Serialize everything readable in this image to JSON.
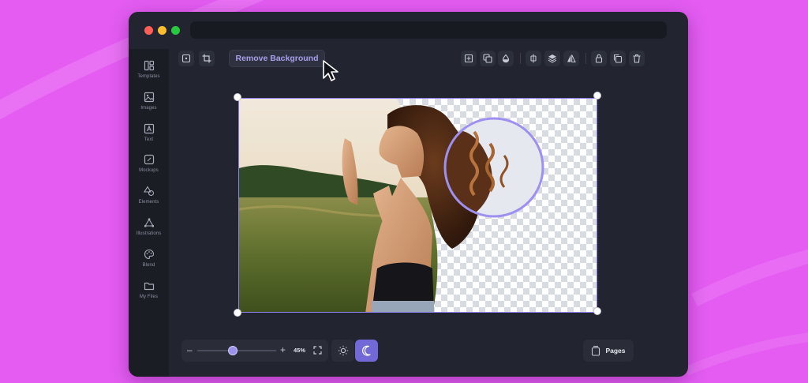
{
  "window": {
    "traffic_lights": [
      "#ff5f57",
      "#febc2e",
      "#28c840"
    ]
  },
  "sidebar": {
    "items": [
      {
        "label": "Templates",
        "icon": "templates-icon"
      },
      {
        "label": "Images",
        "icon": "image-icon"
      },
      {
        "label": "Text",
        "icon": "text-icon"
      },
      {
        "label": "Mockups",
        "icon": "mockup-icon"
      },
      {
        "label": "Elements",
        "icon": "shapes-icon"
      },
      {
        "label": "Illustrations",
        "icon": "illustration-icon"
      },
      {
        "label": "Blend",
        "icon": "palette-icon"
      },
      {
        "label": "My Files",
        "icon": "folder-icon"
      }
    ]
  },
  "toolbar": {
    "remove_background_label": "Remove Background",
    "left_tools": [
      "replace-image-icon",
      "crop-icon"
    ],
    "right_tools": [
      "align-center-icon",
      "arrange-icon",
      "opacity-icon",
      "distribute-icon",
      "layers-icon",
      "flip-icon",
      "lock-icon",
      "duplicate-icon",
      "delete-icon"
    ]
  },
  "zoom": {
    "minus": "–",
    "plus": "+",
    "value_label": "45%",
    "level_fraction": 0.45
  },
  "theme": {
    "selected": "dark"
  },
  "pages": {
    "label": "Pages"
  },
  "colors": {
    "background": "#e45cf2",
    "accent": "#8b80ea",
    "window": "#22252f"
  }
}
